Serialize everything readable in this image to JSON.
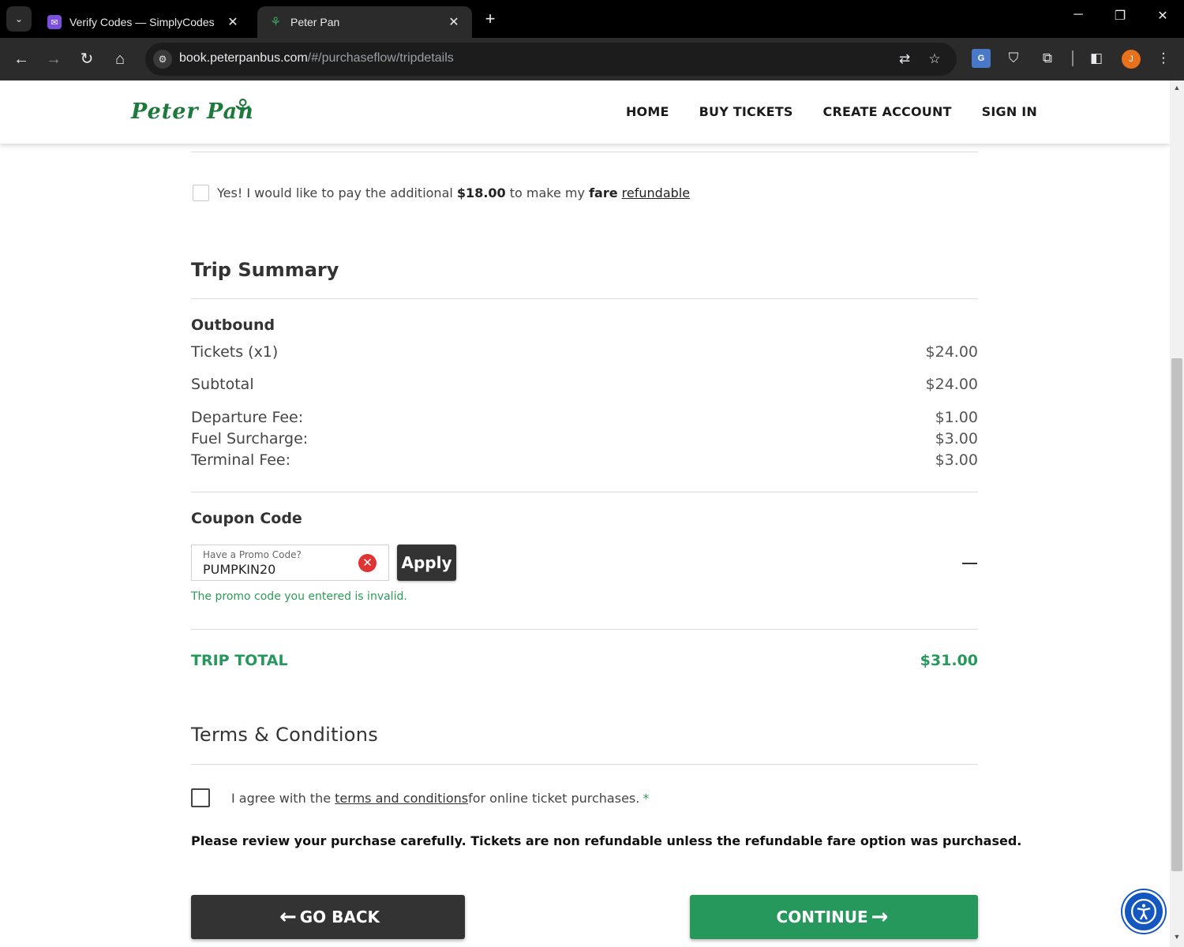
{
  "browser": {
    "tabs": [
      {
        "title": "Verify Codes — SimplyCodes",
        "favicon": "simplycodes-icon",
        "active": false
      },
      {
        "title": "Peter Pan",
        "favicon": "peterpan-icon",
        "active": true
      }
    ],
    "url_host": "book.peterpanbus.com",
    "url_path": "/#/purchaseflow/tripdetails",
    "profile_initial": "J",
    "colors": {
      "chrome_bg": "#000000",
      "toolbar_bg": "#2b2b2b",
      "profile": "#e8711c"
    }
  },
  "site": {
    "logo_text": "Peter Pan",
    "nav": [
      "HOME",
      "BUY TICKETS",
      "CREATE ACCOUNT",
      "SIGN IN"
    ],
    "colors": {
      "brand_green": "#27985b",
      "dark_button": "#333333",
      "error_red": "#e03333"
    }
  },
  "refund": {
    "text_prefix": "Yes! I would like to pay the additional ",
    "amount": "$18.00",
    "text_mid": " to make my ",
    "fare_word": "fare",
    "link": "refundable"
  },
  "summary": {
    "title": "Trip Summary",
    "direction": "Outbound",
    "tickets_label": "Tickets (x1)",
    "tickets_amount": "$24.00",
    "subtotal_label": "Subtotal",
    "subtotal_amount": "$24.00",
    "fees": [
      {
        "label": "Departure Fee:",
        "amount": "$1.00"
      },
      {
        "label": "Fuel Surcharge:",
        "amount": "$3.00"
      },
      {
        "label": "Terminal Fee:",
        "amount": "$3.00"
      }
    ]
  },
  "coupon": {
    "title": "Coupon Code",
    "placeholder": "Have a Promo Code?",
    "value": "PUMPKIN20",
    "apply_label": "Apply",
    "error": "The promo code you entered is invalid."
  },
  "total": {
    "label": "TRIP TOTAL",
    "amount": "$31.00"
  },
  "terms": {
    "title": "Terms & Conditions",
    "agree_prefix": "I agree with the ",
    "agree_link": "terms and conditions ",
    "agree_suffix": "for online ticket purchases.",
    "required_mark": "*",
    "review_note": "Please review your purchase carefully. Tickets are non refundable unless the refundable fare option was purchased."
  },
  "actions": {
    "back_label": "GO BACK",
    "continue_label": "CONTINUE"
  }
}
